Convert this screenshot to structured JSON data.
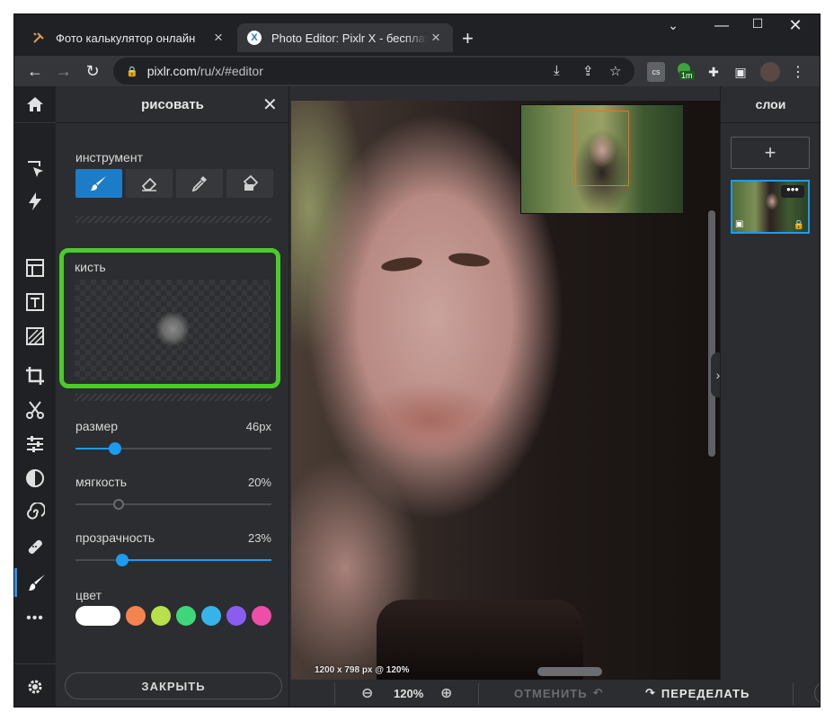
{
  "browser": {
    "tabs": [
      {
        "title": "Фото калькулятор онлайн",
        "active": false,
        "favicon": "tools-icon"
      },
      {
        "title": "Photo Editor: Pixlr X - бесплатный",
        "active": true,
        "favicon": "pixlr-x-icon"
      }
    ],
    "address": {
      "host": "pixlr.com",
      "path": "/ru/x/#editor"
    },
    "extension_badge": "1m",
    "extension_cs": "cs"
  },
  "left_toolbar": {
    "icons": [
      "home-icon",
      "arrange-icon",
      "auto-fix-icon",
      "layout-icon",
      "text-icon",
      "pattern-icon",
      "crop-icon",
      "cutout-icon",
      "adjust-icon",
      "filter-icon",
      "liquify-icon",
      "retouch-icon",
      "draw-icon",
      "more-icon",
      "settings-icon"
    ],
    "active": "draw-icon",
    "more": "•••"
  },
  "draw_panel": {
    "title": "рисовать",
    "tool_label": "инструмент",
    "tools": [
      "brush",
      "eraser",
      "picker",
      "fill"
    ],
    "brush_label": "кисть",
    "size_label": "размер",
    "size_value": "46px",
    "size_level": 0.2,
    "softness_label": "мягкость",
    "softness_value": "20%",
    "softness_level": 0.22,
    "opacity_label": "прозрачность",
    "opacity_value": "23%",
    "opacity_level": 0.24,
    "color_label": "цвет",
    "colors": [
      "#ffffff",
      "#f5834e",
      "#b7e04a",
      "#3fd67a",
      "#36b4ea",
      "#8a5cf0",
      "#ee4ea8"
    ],
    "close_label": "ЗАКРЫТЬ"
  },
  "canvas": {
    "image_info": "1200 x 798 px @ 120%"
  },
  "layers": {
    "title": "слои",
    "add": "+",
    "more": "•••"
  },
  "bottom_bar": {
    "zoom": "120%",
    "undo_label": "ОТМЕНИТЬ",
    "redo_label": "ПЕРЕДЕЛАТЬ"
  },
  "colors": {
    "accent": "#1d9bf0",
    "highlight": "#4cca2c",
    "minimap_frame": "#ff6a1a"
  }
}
